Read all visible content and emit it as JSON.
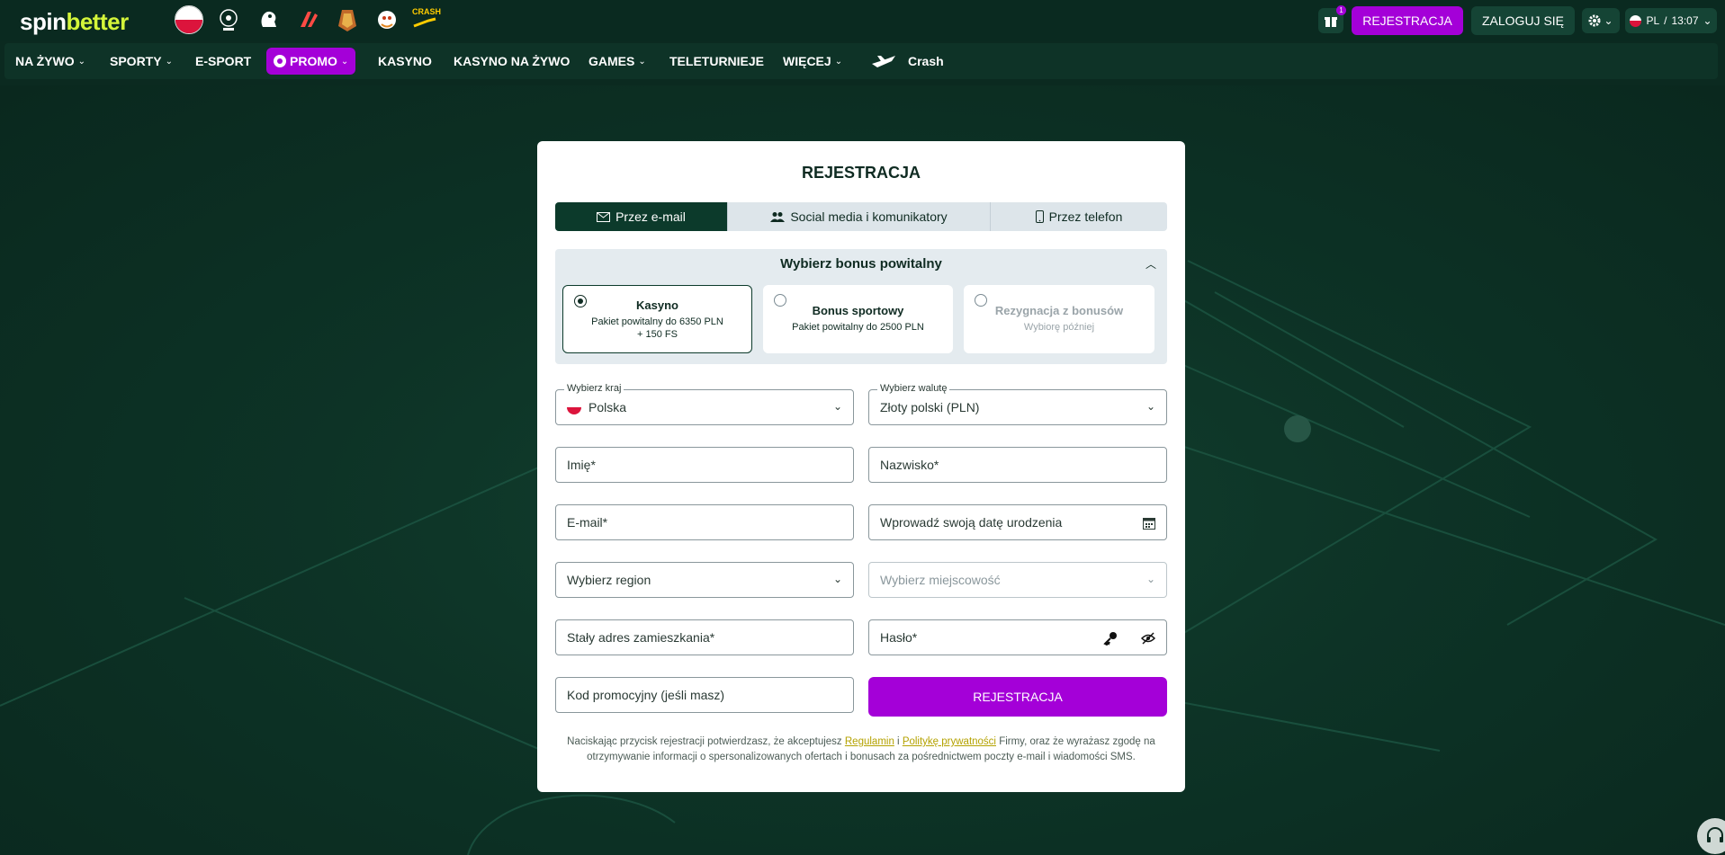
{
  "brand": {
    "spin": "spin",
    "better": "better"
  },
  "top_icons": [
    "poland-flag-icon",
    "champions-league-icon",
    "premier-league-icon",
    "laliga-icon",
    "golden-trophy-icon",
    "mascot-icon"
  ],
  "crash_label": "CRASH",
  "gift_badge": "1",
  "header": {
    "register_label": "REJESTRACJA",
    "login_label": "ZALOGUJ SIĘ",
    "lang": "PL",
    "time": "13:07"
  },
  "nav": {
    "live": "NA ŻYWO",
    "sports": "SPORTY",
    "esport": "E-SPORT",
    "promo": "PROMO",
    "casino": "KASYNO",
    "live_casino": "KASYNO NA ŻYWO",
    "games": "GAMES",
    "tv_games": "TELETURNIEJE",
    "more": "WIĘCEJ",
    "crash": "Crash"
  },
  "form": {
    "title": "REJESTRACJA",
    "tabs": [
      {
        "label": "Przez e-mail",
        "icon": "envelope-icon"
      },
      {
        "label": "Social media i komunikatory",
        "icon": "users-icon"
      },
      {
        "label": "Przez telefon",
        "icon": "phone-icon"
      }
    ],
    "bonus": {
      "title": "Wybierz bonus powitalny",
      "options": [
        {
          "title": "Kasyno",
          "desc": "Pakiet powitalny do 6350 PLN",
          "desc2": "+ 150 FS",
          "selected": true
        },
        {
          "title": "Bonus sportowy",
          "desc": "Pakiet powitalny do 2500 PLN",
          "selected": false
        },
        {
          "title": "Rezygnacja z bonusów",
          "desc": "Wybiorę później",
          "selected": false
        }
      ]
    },
    "country_label": "Wybierz kraj",
    "country_value": "Polska",
    "currency_label": "Wybierz walutę",
    "currency_value": "Złoty polski (PLN)",
    "first_name": "Imię*",
    "last_name": "Nazwisko*",
    "email": "E-mail*",
    "birthdate": "Wprowadź swoją datę urodzenia",
    "region": "Wybierz region",
    "city": "Wybierz miejscowość",
    "address": "Stały adres zamieszkania*",
    "password": "Hasło*",
    "promo_code": "Kod promocyjny (jeśli masz)",
    "submit": "REJESTRACJA",
    "terms": {
      "part1": "Naciskając przycisk rejestracji potwierdzasz, że akceptujesz ",
      "link1": "Regulamin",
      "and": " i ",
      "link2": "Politykę prywatności",
      "part2": " Firmy, oraz że wyrażasz zgodę na otrzymywanie informacji o spersonalizowanych ofertach i bonusach za pośrednictwem poczty e-mail i wiadomości SMS."
    }
  },
  "colors": {
    "accent": "#a400d8",
    "dark_green": "#0c3a2b",
    "brand_lime": "#d4f53a"
  }
}
